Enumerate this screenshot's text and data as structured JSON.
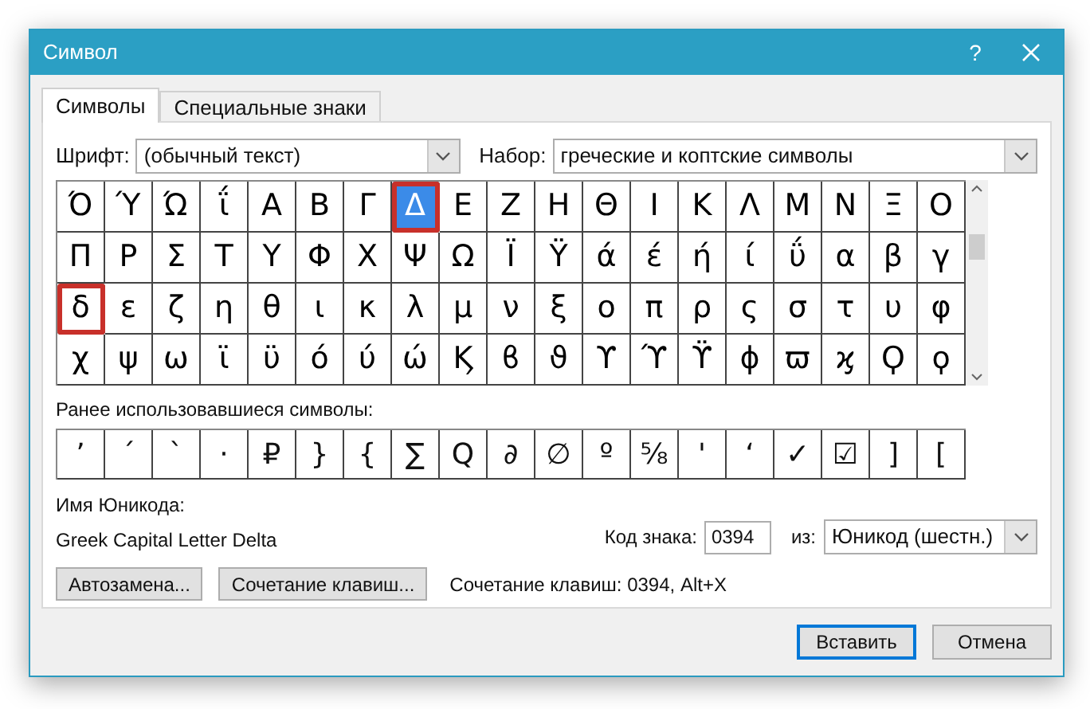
{
  "window": {
    "title": "Символ",
    "help": "?"
  },
  "tabs": [
    {
      "label": "Символы",
      "selected": true
    },
    {
      "label": "Специальные знаки",
      "selected": false
    }
  ],
  "font_field": {
    "label": "Шрифт:",
    "value": "(обычный текст)"
  },
  "subset_field": {
    "label": "Набор:",
    "value": "греческие и коптские символы"
  },
  "symbol_grid": {
    "rows": [
      [
        {
          "char": "Ό",
          "selected": false,
          "highlighted": false
        },
        {
          "char": "Ύ",
          "selected": false,
          "highlighted": false
        },
        {
          "char": "Ώ",
          "selected": false,
          "highlighted": false
        },
        {
          "char": "ΐ",
          "selected": false,
          "highlighted": false
        },
        {
          "char": "Α",
          "selected": false,
          "highlighted": false
        },
        {
          "char": "Β",
          "selected": false,
          "highlighted": false
        },
        {
          "char": "Γ",
          "selected": false,
          "highlighted": false
        },
        {
          "char": "Δ",
          "selected": true,
          "highlighted": true
        },
        {
          "char": "Ε",
          "selected": false,
          "highlighted": false
        },
        {
          "char": "Ζ",
          "selected": false,
          "highlighted": false
        },
        {
          "char": "Η",
          "selected": false,
          "highlighted": false
        },
        {
          "char": "Θ",
          "selected": false,
          "highlighted": false
        },
        {
          "char": "Ι",
          "selected": false,
          "highlighted": false
        },
        {
          "char": "Κ",
          "selected": false,
          "highlighted": false
        },
        {
          "char": "Λ",
          "selected": false,
          "highlighted": false
        },
        {
          "char": "Μ",
          "selected": false,
          "highlighted": false
        },
        {
          "char": "Ν",
          "selected": false,
          "highlighted": false
        },
        {
          "char": "Ξ",
          "selected": false,
          "highlighted": false
        },
        {
          "char": "Ο",
          "selected": false,
          "highlighted": false
        }
      ],
      [
        {
          "char": "Π",
          "selected": false,
          "highlighted": false
        },
        {
          "char": "Ρ",
          "selected": false,
          "highlighted": false
        },
        {
          "char": "Σ",
          "selected": false,
          "highlighted": false
        },
        {
          "char": "Τ",
          "selected": false,
          "highlighted": false
        },
        {
          "char": "Υ",
          "selected": false,
          "highlighted": false
        },
        {
          "char": "Φ",
          "selected": false,
          "highlighted": false
        },
        {
          "char": "Χ",
          "selected": false,
          "highlighted": false
        },
        {
          "char": "Ψ",
          "selected": false,
          "highlighted": false
        },
        {
          "char": "Ω",
          "selected": false,
          "highlighted": false
        },
        {
          "char": "Ϊ",
          "selected": false,
          "highlighted": false
        },
        {
          "char": "Ϋ",
          "selected": false,
          "highlighted": false
        },
        {
          "char": "ά",
          "selected": false,
          "highlighted": false
        },
        {
          "char": "έ",
          "selected": false,
          "highlighted": false
        },
        {
          "char": "ή",
          "selected": false,
          "highlighted": false
        },
        {
          "char": "ί",
          "selected": false,
          "highlighted": false
        },
        {
          "char": "ΰ",
          "selected": false,
          "highlighted": false
        },
        {
          "char": "α",
          "selected": false,
          "highlighted": false
        },
        {
          "char": "β",
          "selected": false,
          "highlighted": false
        },
        {
          "char": "γ",
          "selected": false,
          "highlighted": false
        }
      ],
      [
        {
          "char": "δ",
          "selected": false,
          "highlighted": true
        },
        {
          "char": "ε",
          "selected": false,
          "highlighted": false
        },
        {
          "char": "ζ",
          "selected": false,
          "highlighted": false
        },
        {
          "char": "η",
          "selected": false,
          "highlighted": false
        },
        {
          "char": "θ",
          "selected": false,
          "highlighted": false
        },
        {
          "char": "ι",
          "selected": false,
          "highlighted": false
        },
        {
          "char": "κ",
          "selected": false,
          "highlighted": false
        },
        {
          "char": "λ",
          "selected": false,
          "highlighted": false
        },
        {
          "char": "μ",
          "selected": false,
          "highlighted": false
        },
        {
          "char": "ν",
          "selected": false,
          "highlighted": false
        },
        {
          "char": "ξ",
          "selected": false,
          "highlighted": false
        },
        {
          "char": "ο",
          "selected": false,
          "highlighted": false
        },
        {
          "char": "π",
          "selected": false,
          "highlighted": false
        },
        {
          "char": "ρ",
          "selected": false,
          "highlighted": false
        },
        {
          "char": "ς",
          "selected": false,
          "highlighted": false
        },
        {
          "char": "σ",
          "selected": false,
          "highlighted": false
        },
        {
          "char": "τ",
          "selected": false,
          "highlighted": false
        },
        {
          "char": "υ",
          "selected": false,
          "highlighted": false
        },
        {
          "char": "φ",
          "selected": false,
          "highlighted": false
        }
      ],
      [
        {
          "char": "χ",
          "selected": false,
          "highlighted": false
        },
        {
          "char": "ψ",
          "selected": false,
          "highlighted": false
        },
        {
          "char": "ω",
          "selected": false,
          "highlighted": false
        },
        {
          "char": "ϊ",
          "selected": false,
          "highlighted": false
        },
        {
          "char": "ϋ",
          "selected": false,
          "highlighted": false
        },
        {
          "char": "ό",
          "selected": false,
          "highlighted": false
        },
        {
          "char": "ύ",
          "selected": false,
          "highlighted": false
        },
        {
          "char": "ώ",
          "selected": false,
          "highlighted": false
        },
        {
          "char": "Ϗ",
          "selected": false,
          "highlighted": false
        },
        {
          "char": "ϐ",
          "selected": false,
          "highlighted": false
        },
        {
          "char": "ϑ",
          "selected": false,
          "highlighted": false
        },
        {
          "char": "ϒ",
          "selected": false,
          "highlighted": false
        },
        {
          "char": "ϓ",
          "selected": false,
          "highlighted": false
        },
        {
          "char": "ϔ",
          "selected": false,
          "highlighted": false
        },
        {
          "char": "ϕ",
          "selected": false,
          "highlighted": false
        },
        {
          "char": "ϖ",
          "selected": false,
          "highlighted": false
        },
        {
          "char": "ϗ",
          "selected": false,
          "highlighted": false
        },
        {
          "char": "Ϙ",
          "selected": false,
          "highlighted": false
        },
        {
          "char": "ϙ",
          "selected": false,
          "highlighted": false
        }
      ]
    ]
  },
  "recent": {
    "label": "Ранее использовавшиеся символы:",
    "symbols": [
      "’",
      "´",
      "`",
      "·",
      "₽",
      "}",
      "{",
      "∑",
      "Ԛ",
      "∂",
      "∅",
      "º",
      "⅝",
      "'",
      "‘",
      "✓",
      "☑",
      "]",
      "["
    ]
  },
  "unicode_name": {
    "label": "Имя Юникода:",
    "value": "Greek Capital Letter Delta"
  },
  "char_code": {
    "label": "Код знака:",
    "value": "0394"
  },
  "code_from": {
    "label": "из:",
    "value": "Юникод (шестн.)"
  },
  "buttons": [
    "Автозамена...",
    "Сочетание клавиш..."
  ],
  "shortcut_text": "Сочетание клавиш: 0394, Alt+X",
  "footer_buttons": [
    {
      "label": "Вставить",
      "default": true
    },
    {
      "label": "Отмена",
      "default": false
    }
  ]
}
